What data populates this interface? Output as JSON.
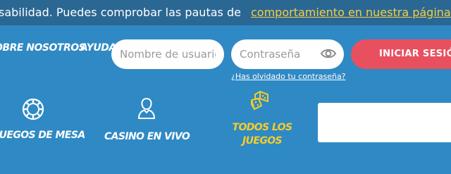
{
  "banner": {
    "text": "sabilidad. Puedes comprobar las pautas de",
    "link": "comportamiento en nuestra página"
  },
  "nav": {
    "about": "obre Nosotros",
    "help": "Ayuda"
  },
  "login": {
    "username_placeholder": "Nombre de usuario",
    "password_placeholder": "Contraseña",
    "submit": "INICIAR SESIÓN",
    "forgot": "¿Has olvidado tu contraseña?"
  },
  "categories": {
    "table_games": "Juegos de Mesa",
    "live_casino": "Casino en Vivo",
    "all_games": "Todos los juegos"
  },
  "colors": {
    "background": "#2f89c4",
    "banner": "#2b6793",
    "accent_yellow": "#f5cd2a",
    "login_button": "#e85060"
  },
  "icons": {
    "table_games": "poker-chip-icon",
    "live_casino": "dealer-person-icon",
    "all_games": "dice-icon",
    "password_toggle": "eye-icon"
  }
}
